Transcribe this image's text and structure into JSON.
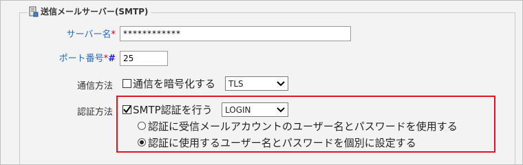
{
  "section": {
    "title": "送信メールサーバー(SMTP)"
  },
  "server_name": {
    "label": "サーバー名",
    "required_mark": "*",
    "value": "************"
  },
  "port": {
    "label": "ポート番号",
    "required_mark": "*",
    "hash_mark": "#",
    "value": "25"
  },
  "comm": {
    "label": "通信方法",
    "encrypt_label": "通信を暗号化する",
    "encrypt_checked": false,
    "protocol_selected": "TLS"
  },
  "auth": {
    "label": "認証方法",
    "smtp_auth_label": "SMTP認証を行う",
    "smtp_auth_checked": true,
    "method_selected": "LOGIN",
    "option_receive": "認証に受信メールアカウントのユーザー名とパスワードを使用する",
    "option_separate": "認証に使用するユーザー名とパスワードを個別に設定する",
    "selected_option": "separate"
  },
  "colors": {
    "highlight_border": "#e0141e",
    "label_blue": "#2b68b8",
    "required_red": "#d0021b"
  }
}
